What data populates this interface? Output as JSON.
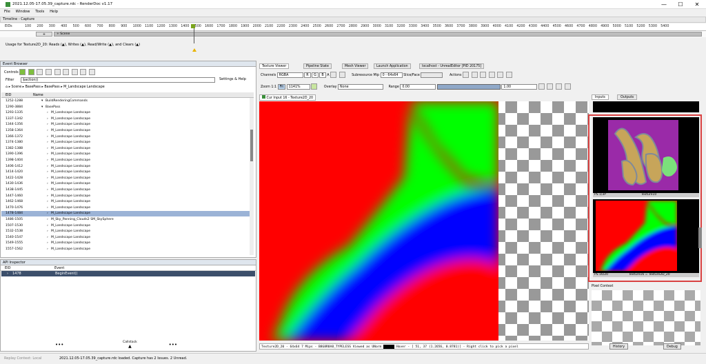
{
  "window": {
    "title": "2021.12.05-17.05.39_capture.rdc - RenderDoc v1.17",
    "minimize": "—",
    "maximize": "☐",
    "close": "✕"
  },
  "menu": [
    "File",
    "Window",
    "Tools",
    "Help"
  ],
  "timeline": {
    "title": "Timeline - Capture",
    "eid_label": "EIDs",
    "ticks": [
      "100",
      "200",
      "300",
      "400",
      "500",
      "600",
      "700",
      "800",
      "900",
      "1000",
      "1100",
      "1200",
      "1300",
      "1400",
      "1500",
      "1600",
      "1700",
      "1800",
      "1900",
      "2000",
      "2100",
      "2200",
      "2300",
      "2400",
      "2500",
      "2600",
      "2700",
      "2800",
      "2900",
      "3000",
      "3100",
      "3200",
      "3300",
      "3400",
      "3500",
      "3600",
      "3700",
      "3800",
      "3900",
      "4000",
      "4100",
      "4200",
      "4300",
      "4400",
      "4500",
      "4600",
      "4700",
      "4800",
      "4900",
      "5000",
      "5100",
      "5200",
      "5300",
      "5400"
    ],
    "plus": "+",
    "scene_label": "+ Scene",
    "usage": "Usage for Texture2D_20: Reads (▲), Writes (▲), Read/Write (▲), and Clears (▲)"
  },
  "event_browser": {
    "title": "Event Browser",
    "controls_label": "Controls",
    "filter_label": "Filter",
    "filter_value": "$action()",
    "settings": "Settings & Help",
    "breadcrumb": [
      "Scene",
      "BasePass",
      "BasePass",
      "M_Landscape Landscape"
    ],
    "col_eid": "EID",
    "col_name": "Name",
    "rows": [
      {
        "eid": "1252-1288",
        "name": "BuildRenderingCommands",
        "indent": 1
      },
      {
        "eid": "1290-3884",
        "name": "BasePass",
        "indent": 1
      },
      {
        "eid": "1293-1335",
        "name": "M_Landscape Landscape",
        "indent": 2
      },
      {
        "eid": "1337-1342",
        "name": "M_Landscape Landscape",
        "indent": 2
      },
      {
        "eid": "1344-1356",
        "name": "M_Landscape Landscape",
        "indent": 2
      },
      {
        "eid": "1358-1364",
        "name": "M_Landscape Landscape",
        "indent": 2
      },
      {
        "eid": "1366-1372",
        "name": "M_Landscape Landscape",
        "indent": 2
      },
      {
        "eid": "1374-1380",
        "name": "M_Landscape Landscape",
        "indent": 2
      },
      {
        "eid": "1382-1388",
        "name": "M_Landscape Landscape",
        "indent": 2
      },
      {
        "eid": "1390-1396",
        "name": "M_Landscape Landscape",
        "indent": 2
      },
      {
        "eid": "1398-1404",
        "name": "M_Landscape Landscape",
        "indent": 2
      },
      {
        "eid": "1406-1412",
        "name": "M_Landscape Landscape",
        "indent": 2
      },
      {
        "eid": "1414-1420",
        "name": "M_Landscape Landscape",
        "indent": 2
      },
      {
        "eid": "1422-1428",
        "name": "M_Landscape Landscape",
        "indent": 2
      },
      {
        "eid": "1430-1436",
        "name": "M_Landscape Landscape",
        "indent": 2
      },
      {
        "eid": "1438-1445",
        "name": "M_Landscape Landscape",
        "indent": 2
      },
      {
        "eid": "1447-1460",
        "name": "M_Landscape Landscape",
        "indent": 2
      },
      {
        "eid": "1462-1468",
        "name": "M_Landscape Landscape",
        "indent": 2
      },
      {
        "eid": "1470-1476",
        "name": "M_Landscape Landscape",
        "indent": 2
      },
      {
        "eid": "1478-1484",
        "name": "M_Landscape Landscape",
        "indent": 2,
        "selected": true
      },
      {
        "eid": "1486-1505",
        "name": "M_Sky_Panning_Clouds2 SM_SkySphere",
        "indent": 2
      },
      {
        "eid": "1507-1530",
        "name": "M_Landscape Landscape",
        "indent": 2
      },
      {
        "eid": "1532-1538",
        "name": "M_Landscape Landscape",
        "indent": 2
      },
      {
        "eid": "1540-1547",
        "name": "M_Landscape Landscape",
        "indent": 2
      },
      {
        "eid": "1549-1555",
        "name": "M_Landscape Landscape",
        "indent": 2
      },
      {
        "eid": "1557-1562",
        "name": "M_Landscape Landscape",
        "indent": 2
      }
    ]
  },
  "api_inspector": {
    "title": "API Inspector",
    "col_eid": "EID",
    "col_event": "Event",
    "row_eid": "1478",
    "row_event": "BeginEvent()",
    "callstack": "Callstack",
    "more": "•••"
  },
  "status": {
    "left": "Replay Context: Local",
    "msg": "2021.12.05-17.05.39_capture.rdc loaded. Capture has 2 Issues. 2 Unread."
  },
  "tabs": [
    {
      "label": "Texture Viewer",
      "active": true
    },
    {
      "label": "Pipeline State",
      "active": false
    },
    {
      "label": "Mesh Viewer",
      "active": false
    },
    {
      "label": "Launch Application",
      "active": false
    },
    {
      "label": "localhost - UnrealEditor [PID 20175]",
      "active": false
    }
  ],
  "toolbar": {
    "channels_label": "Channels",
    "channels_value": "RGBA",
    "r": "R",
    "g": "G",
    "b": "B",
    "a": "A",
    "subresource": "Subresource",
    "mip_label": "Mip",
    "mip_value": "0 - 64x64",
    "slice_label": "Slice/Face",
    "actions": "Actions",
    "zoom_label": "Zoom",
    "zoom_1to1": "1:1",
    "fit": "Fit",
    "zoom_value": "1141%",
    "overlay_label": "Overlay",
    "overlay_value": "None",
    "range_label": "Range",
    "range_min": "0.00",
    "range_max": "1.00"
  },
  "texture_tab": "Cur Input 16 - Texture2D_20",
  "texture_status": "Texture2D_20 - 64x64 7 Mips - B8G8R8A8_TYPELESS Viewed as UNorm",
  "texture_status_hover": "Hover - [   51,   37 (1.2656, 0.8781)] - Right click to pick a pixel",
  "right": {
    "tab_inputs": "Inputs",
    "tab_outputs": "Outputs",
    "thumb1_caption": "Texture10",
    "thumb1_id": "PS 1/3P",
    "thumb2_caption": "Texture16 = Texture2D_20",
    "thumb2_id": "PS 16/20",
    "pixel_context": "Pixel Context",
    "history": "History",
    "debug": "Debug"
  }
}
